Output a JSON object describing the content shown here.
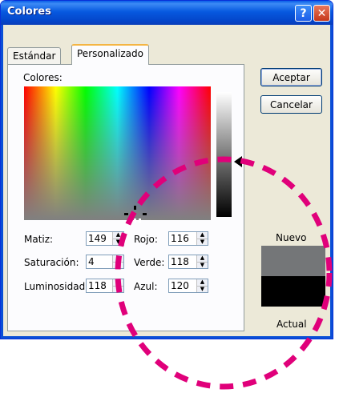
{
  "window": {
    "title": "Colores",
    "help_label": "?",
    "close_label": "✕"
  },
  "tabs": [
    {
      "label": "Estándar",
      "selected": false
    },
    {
      "label": "Personalizado",
      "selected": true
    }
  ],
  "colors_label": "Colores:",
  "fields": {
    "hue": {
      "label": "Matiz:",
      "value": "149"
    },
    "saturation": {
      "label": "Saturación:",
      "value": "4"
    },
    "luminosity": {
      "label": "Luminosidad:",
      "value": "118"
    },
    "red": {
      "label": "Rojo:",
      "value": "116"
    },
    "green": {
      "label": "Verde:",
      "value": "118"
    },
    "blue": {
      "label": "Azul:",
      "value": "120"
    }
  },
  "buttons": {
    "ok": "Aceptar",
    "cancel": "Cancelar"
  },
  "preview": {
    "new_label": "Nuevo",
    "actual_label": "Actual",
    "new_color": "#747678",
    "actual_color": "#000000"
  },
  "icons": {
    "help": "help-icon",
    "close": "close-icon",
    "spin_up": "spin-up-icon",
    "spin_down": "spin-down-icon",
    "luminosity_pointer": "triangle-left-icon",
    "crosshair": "crosshair-icon"
  },
  "colors": {
    "titlebar": "#0759e0",
    "dialog_bg": "#ece9d8",
    "annotation": "#e0007a"
  }
}
